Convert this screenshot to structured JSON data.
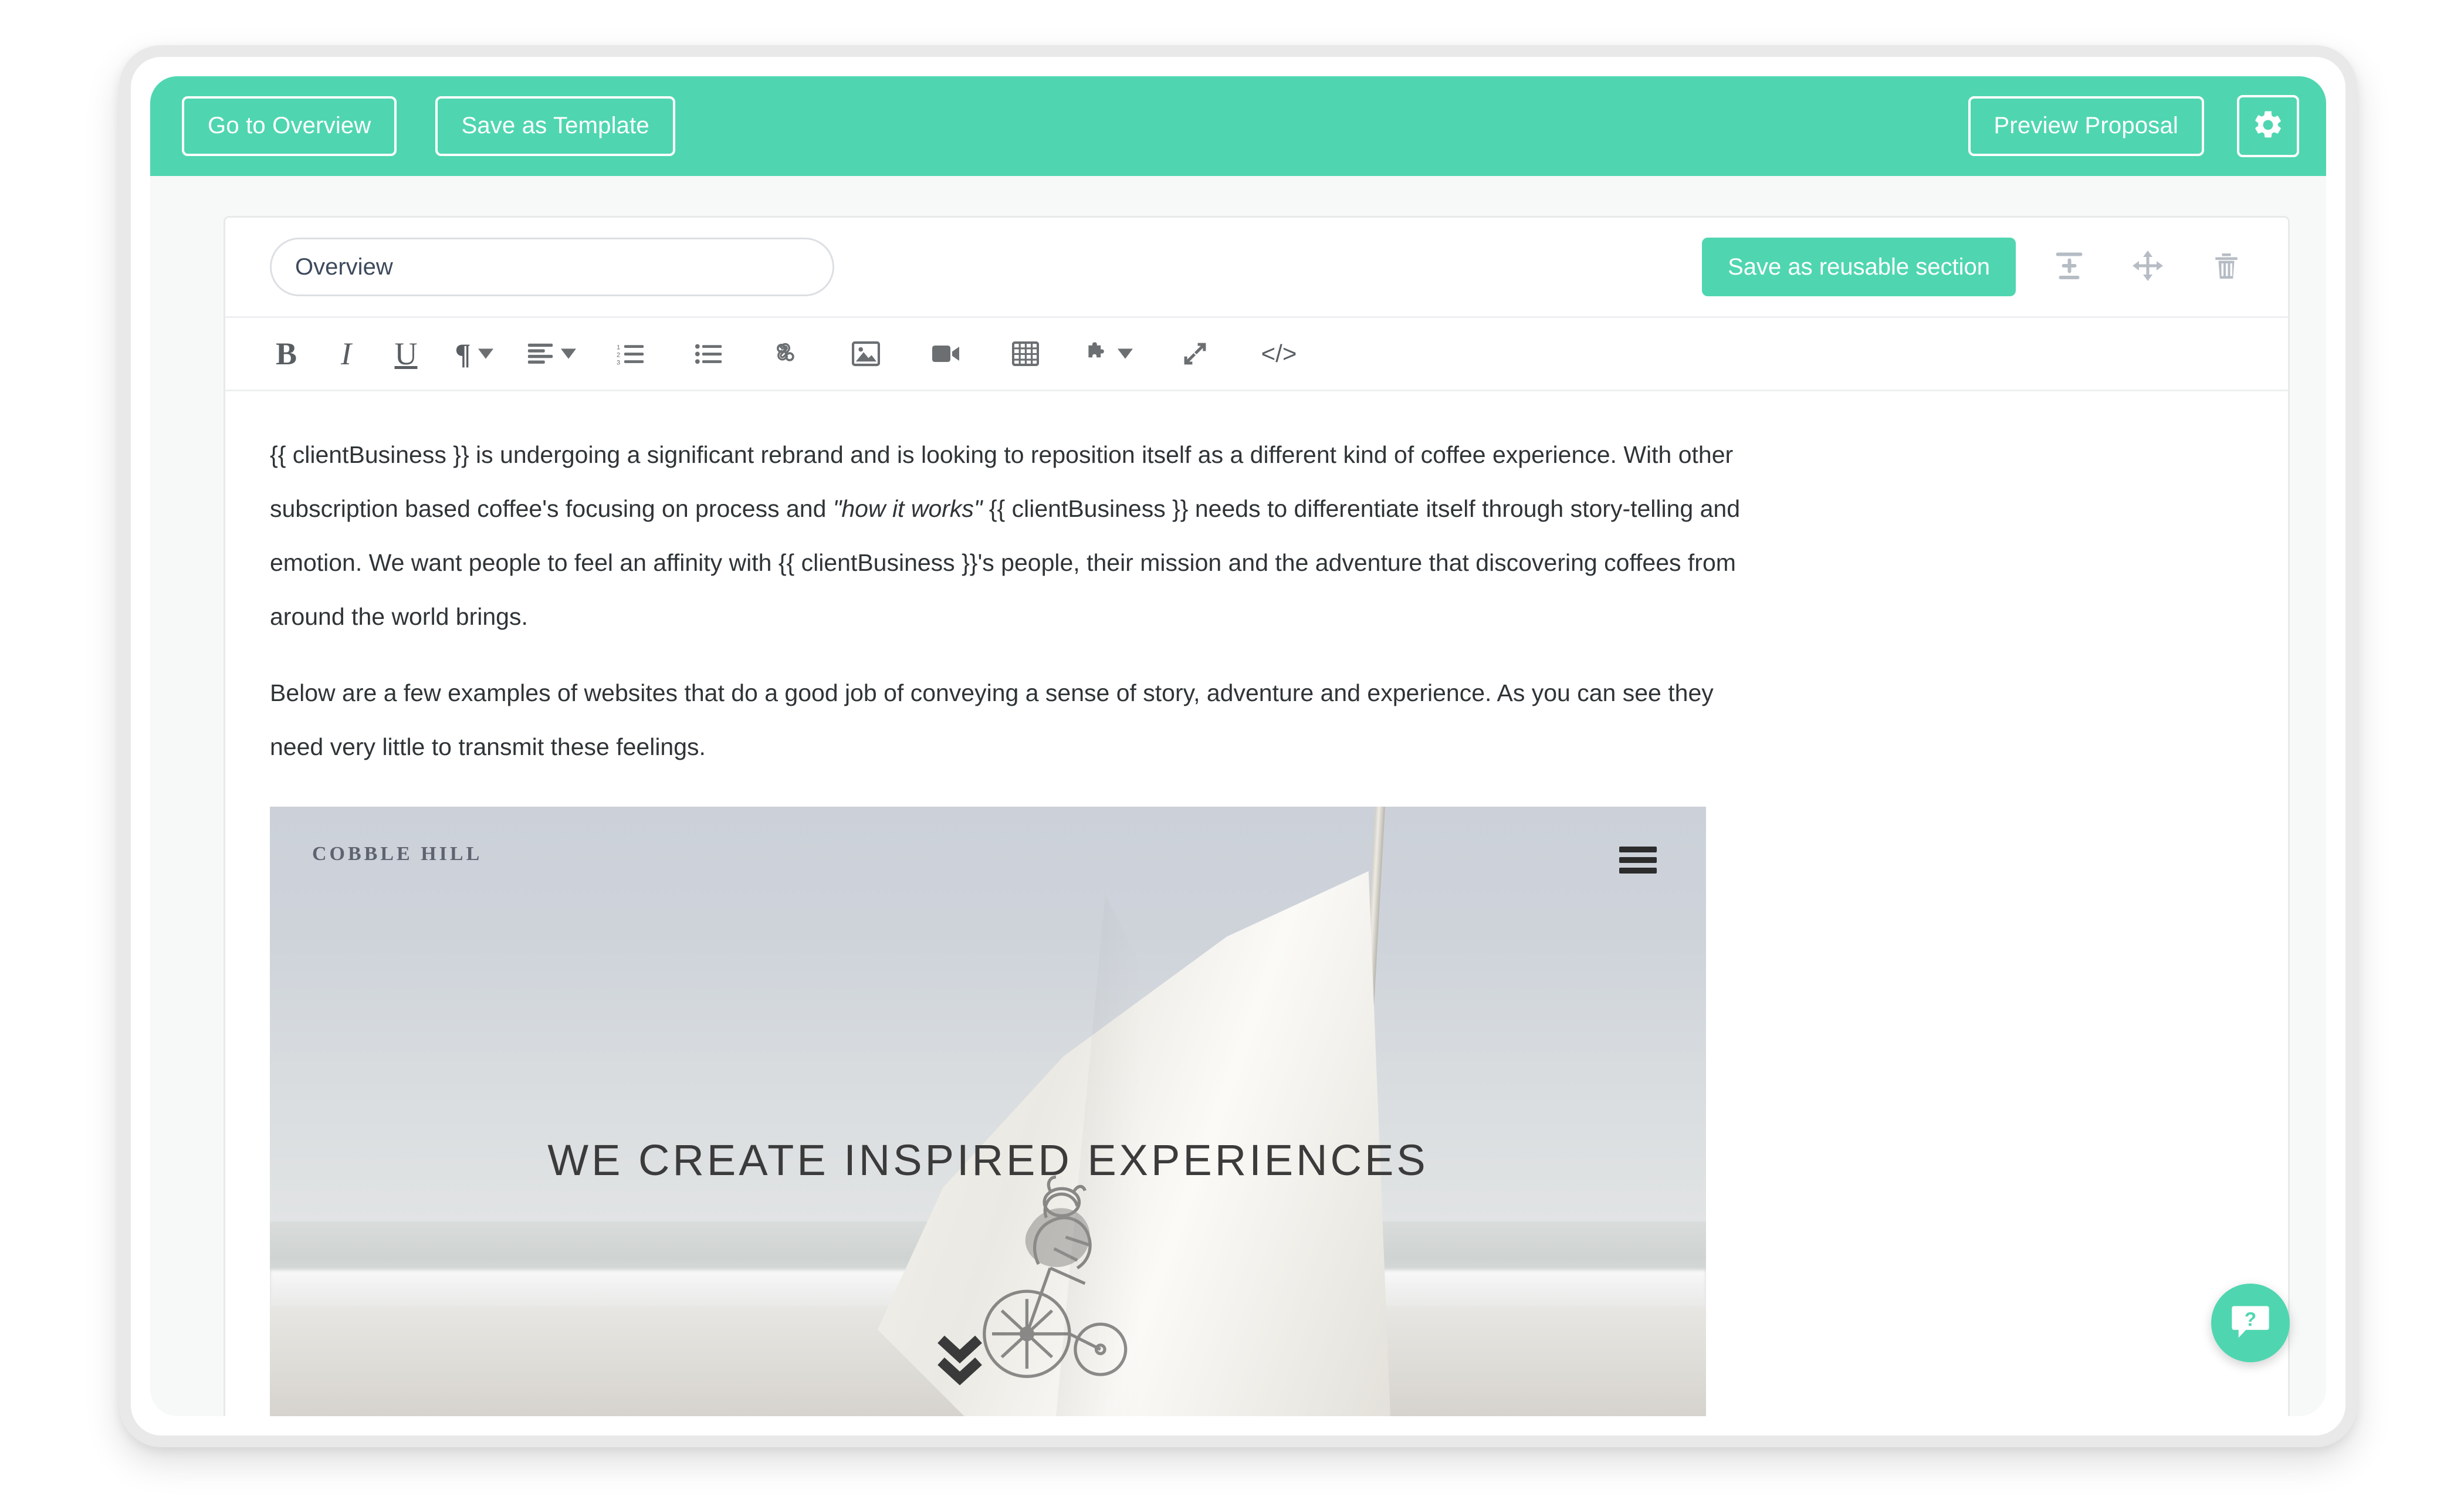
{
  "header": {
    "go_to_overview_label": "Go to Overview",
    "save_as_template_label": "Save as Template",
    "preview_proposal_label": "Preview Proposal",
    "settings_icon": "gear-icon",
    "background_color": "#4fd6b0"
  },
  "section": {
    "title_value": "Overview",
    "title_placeholder": "Section title",
    "save_reusable_label": "Save as reusable section",
    "icons": {
      "collapse": "collapse-expand-icon",
      "move": "move-drag-icon",
      "delete": "trash-icon"
    }
  },
  "toolbar": {
    "items": [
      {
        "name": "bold-icon",
        "glyph": "B"
      },
      {
        "name": "italic-icon",
        "glyph": "I"
      },
      {
        "name": "underline-icon",
        "glyph": "U"
      },
      {
        "name": "paragraph-format-icon",
        "glyph": "¶"
      },
      {
        "name": "align-icon",
        "glyph": "align"
      },
      {
        "name": "ordered-list-icon",
        "glyph": "ol"
      },
      {
        "name": "unordered-list-icon",
        "glyph": "ul"
      },
      {
        "name": "link-icon",
        "glyph": "link"
      },
      {
        "name": "image-icon",
        "glyph": "image"
      },
      {
        "name": "video-icon",
        "glyph": "video"
      },
      {
        "name": "table-icon",
        "glyph": "table"
      },
      {
        "name": "puzzle-plugin-icon",
        "glyph": "puzzle"
      },
      {
        "name": "fullscreen-icon",
        "glyph": "fullscreen"
      },
      {
        "name": "code-view-icon",
        "glyph": "</>"
      }
    ]
  },
  "document": {
    "paragraph_1_part_1": "{{ clientBusiness }} is undergoing a significant rebrand and is looking to reposition itself as a different kind of coffee experience. With other subscription based coffee's focusing on process and ",
    "paragraph_1_quote": "\"how it works\"",
    "paragraph_1_part_2": " {{ clientBusiness }} needs to differentiate itself through story-telling and emotion. We want people to feel an affinity with {{ clientBusiness }}'s people, their mission and the adventure that discovering coffees from around the world brings.",
    "paragraph_2": "Below are a few examples of websites that do a good job of conveying a sense of story, adventure and experience. As you can see they need very little to transmit these feelings."
  },
  "embedded_image": {
    "logo_text": "COBBLE HILL",
    "headline": "WE CREATE INSPIRED EXPERIENCES",
    "menu_icon": "hamburger-menu-icon",
    "scroll_cue_icon": "double-chevron-down-icon"
  },
  "help": {
    "icon": "help-chat-bubble-icon",
    "label": "?"
  }
}
